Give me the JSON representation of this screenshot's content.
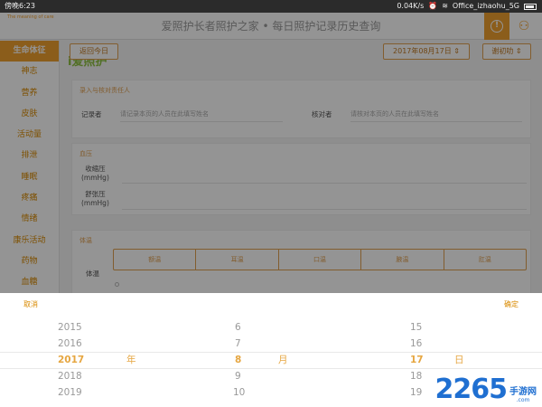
{
  "statusbar": {
    "time": "傍晚6:23",
    "speed": "0.04K/s",
    "network": "Office_izhaohu_5G"
  },
  "app": {
    "logo_text": "i爱照护",
    "logo_sub": "The meaning of care",
    "title": "爱照护长者照护之家 • 每日照护记录历史查询"
  },
  "sidebar": {
    "items": [
      {
        "label": "生命体征"
      },
      {
        "label": "神志"
      },
      {
        "label": "营养"
      },
      {
        "label": "皮肤"
      },
      {
        "label": "活动量"
      },
      {
        "label": "排泄"
      },
      {
        "label": "睡眠"
      },
      {
        "label": "疼痛"
      },
      {
        "label": "情绪"
      },
      {
        "label": "康乐活动"
      },
      {
        "label": "药物"
      },
      {
        "label": "血糖"
      }
    ]
  },
  "toolbar": {
    "back_today": "返回今日",
    "date": "2017年08月17日",
    "resident": "谢初叻"
  },
  "card_record": {
    "title": "录入与核对责任人",
    "recorder_label": "记录者",
    "recorder_placeholder": "请记录本页的人员在此填写姓名",
    "checker_label": "核对者",
    "checker_placeholder": "请核对本页的人员在此填写姓名"
  },
  "card_bp": {
    "title": "血压",
    "systolic_label": "收缩压",
    "systolic_unit": "(mmHg)",
    "diastolic_label": "舒张压",
    "diastolic_unit": "(mmHg)"
  },
  "card_temp": {
    "title": "体温",
    "label": "体温",
    "tabs": [
      "额温",
      "耳温",
      "口温",
      "腋温",
      "肛温"
    ]
  },
  "picker": {
    "cancel": "取消",
    "confirm": "确定",
    "year_unit": "年",
    "month_unit": "月",
    "day_unit": "日",
    "rows": [
      {
        "year": "2015",
        "month": "6",
        "day": "15"
      },
      {
        "year": "2016",
        "month": "7",
        "day": "16"
      },
      {
        "year": "2017",
        "month": "8",
        "day": "17"
      },
      {
        "year": "2018",
        "month": "9",
        "day": "18"
      },
      {
        "year": "2019",
        "month": "10",
        "day": "19"
      }
    ]
  },
  "watermark": {
    "number": "2265",
    "dotcom": ".com",
    "cn": "手游网"
  }
}
